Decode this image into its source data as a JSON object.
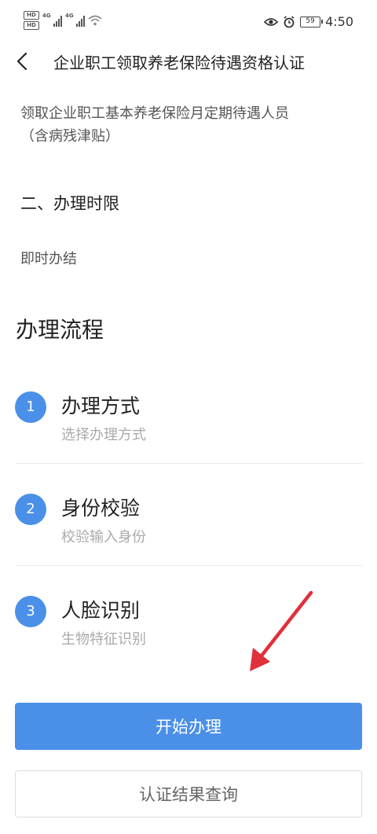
{
  "status_bar": {
    "hd_label": "HD",
    "net1": "4G",
    "net2": "4G",
    "battery": "59",
    "time": "4:50"
  },
  "nav": {
    "title": "企业职工领取养老保险待遇资格认证"
  },
  "content": {
    "intro_line1": "领取企业职工基本养老保险月定期待遇人员",
    "intro_line2": "（含病残津贴）",
    "time_limit_heading": "二、办理时限",
    "time_limit_value": "即时办结",
    "process_title": "办理流程"
  },
  "steps": [
    {
      "number": "1",
      "title": "办理方式",
      "desc": "选择办理方式"
    },
    {
      "number": "2",
      "title": "身份校验",
      "desc": "校验输入身份"
    },
    {
      "number": "3",
      "title": "人脸识别",
      "desc": "生物特征识别"
    }
  ],
  "buttons": {
    "start": "开始办理",
    "query": "认证结果查询"
  },
  "colors": {
    "accent": "#4a90e8",
    "annotation_arrow": "#e0303a"
  }
}
